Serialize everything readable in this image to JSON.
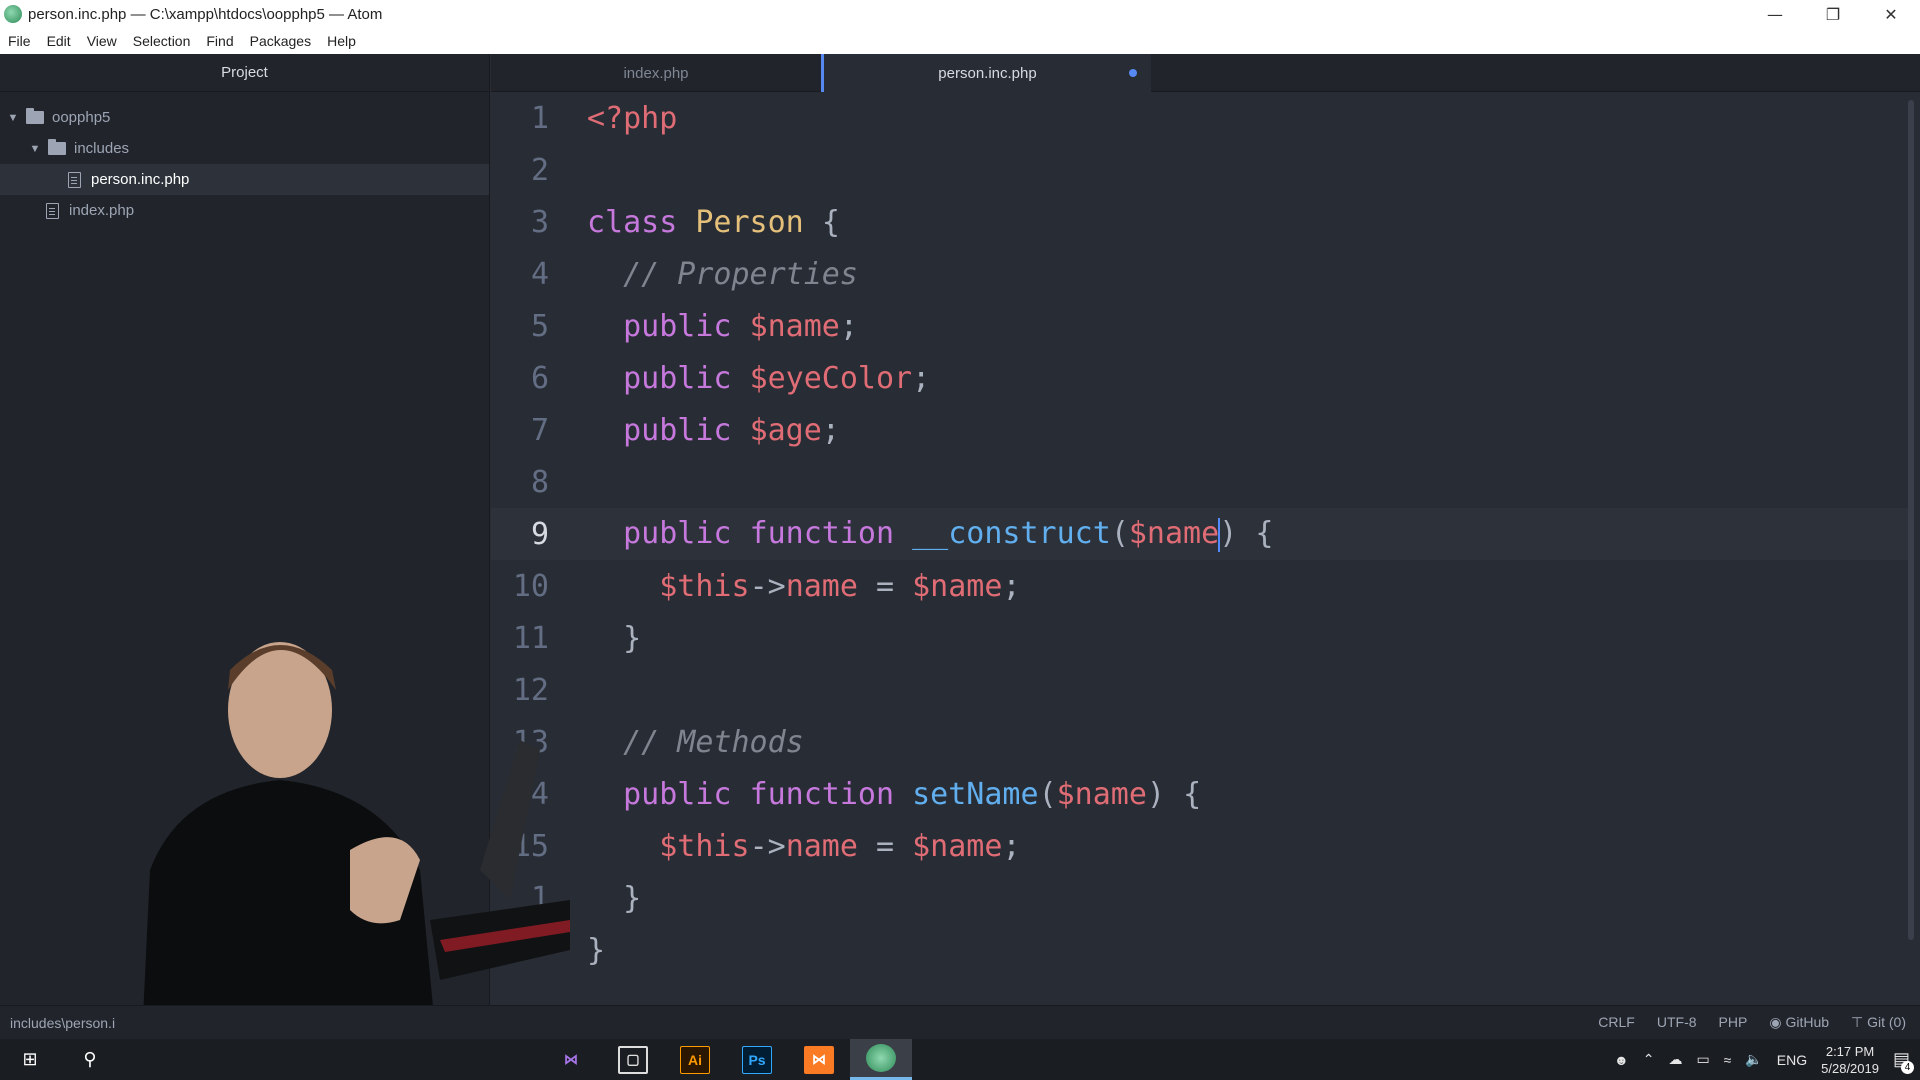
{
  "window": {
    "title": "person.inc.php — C:\\xampp\\htdocs\\oopphp5 — Atom",
    "minimize_icon": "minimize-icon",
    "restore_icon": "restore-icon",
    "close_icon": "close-icon"
  },
  "menu": [
    "File",
    "Edit",
    "View",
    "Selection",
    "Find",
    "Packages",
    "Help"
  ],
  "sidebar": {
    "header": "Project",
    "root_folder": "oopphp5",
    "subfolder": "includes",
    "selected_file": "person.inc.php",
    "other_file": "index.php"
  },
  "tabs": [
    {
      "label": "index.php",
      "active": false
    },
    {
      "label": "person.inc.php",
      "active": true,
      "modified": true
    }
  ],
  "editor": {
    "line_numbers": [
      "1",
      "2",
      "3",
      "4",
      "5",
      "6",
      "7",
      "8",
      "9",
      "10",
      "11",
      "12",
      "13",
      "14",
      "15",
      "1",
      ""
    ],
    "code": {
      "l1": "<?php",
      "l3a": "class",
      "l3b": "Person",
      "l3c": "{",
      "l4": "// Properties",
      "l5a": "public",
      "l5b": "$name",
      "l5c": ";",
      "l6a": "public",
      "l6b": "$eyeColor",
      "l6c": ";",
      "l7a": "public",
      "l7b": "$age",
      "l7c": ";",
      "l9a": "public",
      "l9b": "function",
      "l9c": "__construct",
      "l9d": "(",
      "l9e": "$name",
      "l9f": ")",
      "l9g": "{",
      "l10a": "$this",
      "l10b": "->",
      "l10c": "name",
      "l10d": " = ",
      "l10e": "$name",
      "l10f": ";",
      "l11": "}",
      "l13": "// Methods",
      "l14a": "public",
      "l14b": "function",
      "l14c": "setName",
      "l14d": "(",
      "l14e": "$name",
      "l14f": ")",
      "l14g": "{",
      "l15a": "$this",
      "l15b": "->",
      "l15c": "name",
      "l15d": " = ",
      "l15e": "$name",
      "l15f": ";",
      "l16": "}",
      "l17": "}"
    }
  },
  "status": {
    "path": "includes\\person.i",
    "line_ending": "CRLF",
    "encoding": "UTF-8",
    "grammar": "PHP",
    "github": "GitHub",
    "git": "Git (0)"
  },
  "taskbar": {
    "apps": [
      "Ai",
      "Ps"
    ],
    "language": "ENG",
    "time": "2:17 PM",
    "date": "5/28/2019",
    "notification_badge": "4"
  },
  "colors": {
    "keyword": "#c678dd",
    "class_name": "#e5c07b",
    "variable": "#e06c75",
    "function": "#61afef",
    "comment": "#7f848e",
    "accent": "#568af2"
  }
}
